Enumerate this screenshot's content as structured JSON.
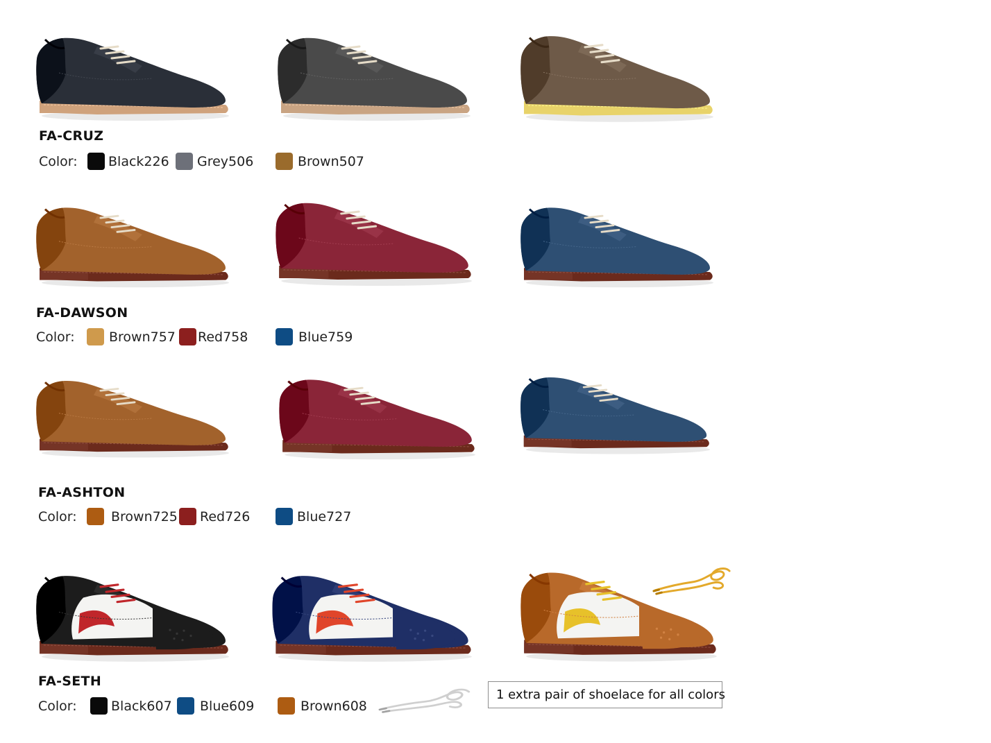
{
  "rows": [
    {
      "model": "FA-CRUZ",
      "color_label": "Color:",
      "colors": [
        {
          "name": "Black226",
          "hex": "#0a0a0a"
        },
        {
          "name": "Grey506",
          "hex": "#6d7079"
        },
        {
          "name": "Brown507",
          "hex": "#9a6b2c"
        }
      ]
    },
    {
      "model": "FA-DAWSON",
      "color_label": "Color:",
      "colors": [
        {
          "name": "Brown757",
          "hex": "#cf9a4c"
        },
        {
          "name": "Red758",
          "hex": "#8c1f1e"
        },
        {
          "name": "Blue759",
          "hex": "#0e4c84"
        }
      ]
    },
    {
      "model": "FA-ASHTON",
      "color_label": "Color:",
      "colors": [
        {
          "name": "Brown725",
          "hex": "#ad5c12"
        },
        {
          "name": "Red726",
          "hex": "#8c1f1e"
        },
        {
          "name": "Blue727",
          "hex": "#0e4c84"
        }
      ]
    },
    {
      "model": "FA-SETH",
      "color_label": "Color:",
      "colors": [
        {
          "name": "Black607",
          "hex": "#0a0a0a"
        },
        {
          "name": "Blue609",
          "hex": "#0e4c84"
        },
        {
          "name": "Brown608",
          "hex": "#ad5c12"
        }
      ]
    }
  ],
  "note": "1 extra pair of shoelace for all colors",
  "shoe_images": [
    {
      "icon": "black-derby-shoe",
      "upper": "#2a2f38",
      "sole": "#cfa27c"
    },
    {
      "icon": "grey-derby-shoe",
      "upper": "#4a4a4a",
      "sole": "#c9a483"
    },
    {
      "icon": "brown-derby-shoe",
      "upper": "#6e5a48",
      "sole": "#e8d36a"
    },
    {
      "icon": "brown-oxford-shoe",
      "upper": "#a2622c",
      "sole": "#6b2a1c"
    },
    {
      "icon": "red-oxford-shoe",
      "upper": "#8a2538",
      "sole": "#6b2a1c"
    },
    {
      "icon": "blue-oxford-shoe",
      "upper": "#2e4f73",
      "sole": "#6b2a1c"
    },
    {
      "icon": "brown-derby-shoe",
      "upper": "#a2622c",
      "sole": "#6b2a1c"
    },
    {
      "icon": "red-derby-shoe",
      "upper": "#8a2538",
      "sole": "#6b2a1c"
    },
    {
      "icon": "blue-derby-shoe",
      "upper": "#2e4f73",
      "sole": "#6b2a1c"
    },
    {
      "icon": "black-white-wingtip-shoe",
      "upper": "#1c1c1c",
      "accent": "#c0262b",
      "sole": "#6b2a1c"
    },
    {
      "icon": "blue-white-wingtip-shoe",
      "upper": "#1f2f66",
      "accent": "#e0452a",
      "sole": "#6b2a1c"
    },
    {
      "icon": "brown-white-wingtip-shoe",
      "upper": "#b8692a",
      "accent": "#e7c12a",
      "sole": "#6b2a1c"
    }
  ],
  "laces": [
    {
      "icon": "yellow-shoelace",
      "hex": "#e3a92b"
    },
    {
      "icon": "white-shoelace",
      "hex": "#cfcfcf"
    }
  ]
}
